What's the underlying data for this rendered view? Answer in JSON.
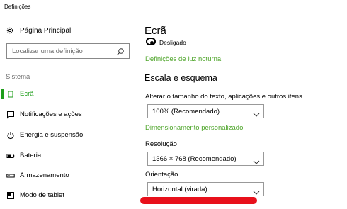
{
  "app": {
    "title": "Definições"
  },
  "sidebar": {
    "home_label": "Página Principal",
    "search_placeholder": "Localizar uma definição",
    "section_label": "Sistema",
    "items": [
      {
        "label": "Ecrã",
        "icon": "display-icon",
        "active": true
      },
      {
        "label": "Notificações e ações",
        "icon": "notifications-icon",
        "active": false
      },
      {
        "label": "Energia e suspensão",
        "icon": "power-icon",
        "active": false
      },
      {
        "label": "Bateria",
        "icon": "battery-icon",
        "active": false
      },
      {
        "label": "Armazenamento",
        "icon": "storage-icon",
        "active": false
      },
      {
        "label": "Modo de tablet",
        "icon": "tablet-mode-icon",
        "active": false
      }
    ]
  },
  "main": {
    "title": "Ecrã",
    "night_light_state": "Desligado",
    "night_light_link": "Definições de luz noturna",
    "scale_heading": "Escala e esquema",
    "scale_label": "Alterar o tamanho do texto, aplicações e outros itens",
    "scale_value": "100% (Recomendado)",
    "custom_scaling_link": "Dimensionamento personalizado",
    "resolution_label": "Resolução",
    "resolution_value": "1366 × 768 (Recomendado)",
    "orientation_label": "Orientação",
    "orientation_value": "Horizontal (virada)"
  },
  "colors": {
    "accent": "#1e9e1a",
    "link": "#4ea52a",
    "annotation": "#e8101b"
  }
}
